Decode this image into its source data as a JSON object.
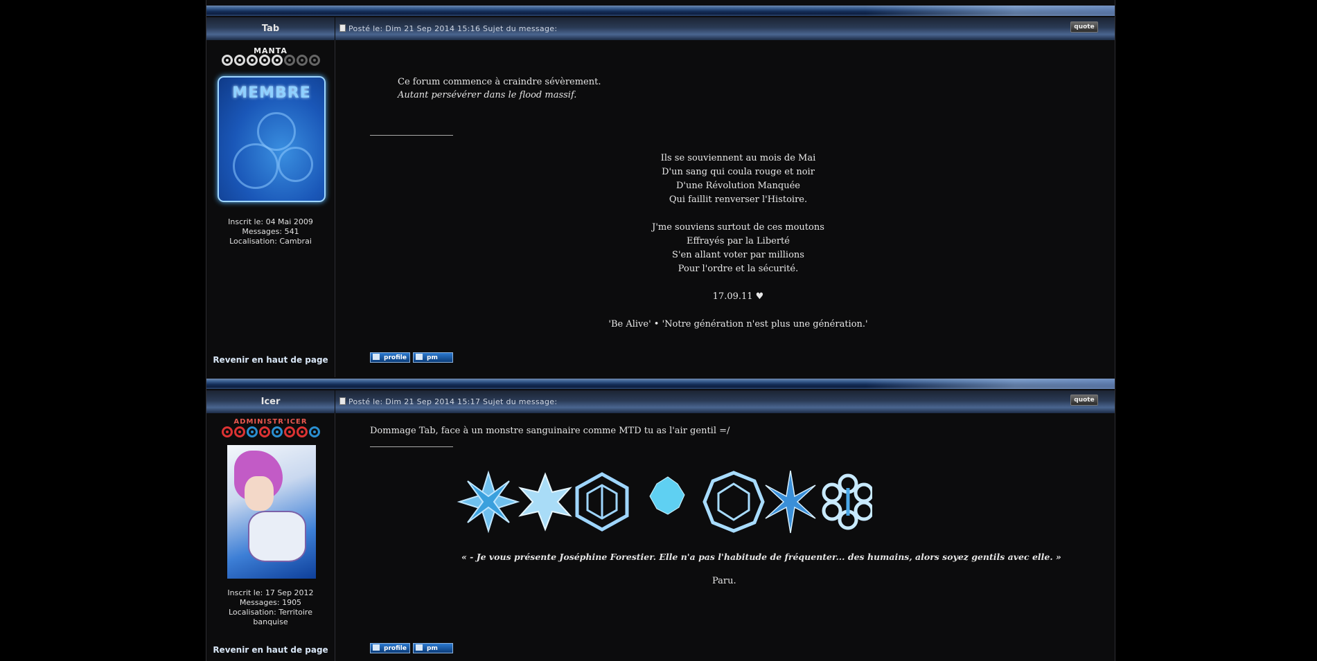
{
  "posts": [
    {
      "author": "Tab",
      "header": "Posté le: Dim 21 Sep 2014 15:16    Sujet du message:",
      "quote_label": "quote",
      "rank_title": "MANTA",
      "avatar_text": "MEMBRE",
      "joined": "Inscrit le: 04 Mai 2009",
      "messages": "Messages: 541",
      "location": "Localisation: Cambrai",
      "body_line1": "Ce forum commence à craindre sévèrement.",
      "body_line2": "Autant persévérer dans le flood massif.",
      "signature": [
        "Ils se souviennent au mois de Mai",
        "D'un sang qui coula rouge et noir",
        "D'une Révolution Manquée",
        "Qui faillit renverser l'Histoire.",
        "",
        "J'me souviens surtout de ces moutons",
        "Effrayés par la Liberté",
        "S'en allant voter par millions",
        "Pour l'ordre et la sécurité.",
        "",
        "17.09.11 ♥",
        "",
        "'Be Alive' • 'Notre génération n'est plus une génération.'"
      ],
      "back_to_top": "Revenir en haut de page",
      "profile_label": "profile",
      "pm_label": "pm"
    },
    {
      "author": "Icer",
      "header": "Posté le: Dim 21 Sep 2014 15:17    Sujet du message:",
      "quote_label": "quote",
      "rank_title": "ADMINISTR'ICER",
      "joined": "Inscrit le: 17 Sep 2012",
      "messages": "Messages: 1905",
      "location": "Localisation: Territoire banquise",
      "body_line1": "Dommage Tab, face à un monstre sanguinaire comme MTD tu as l'air gentil =/",
      "quote_text": "« - Je vous présente Joséphine Forestier. Elle n'a pas l'habitude de fréquenter... des humains, alors soyez gentils avec elle. »",
      "sig_name": "Paru.",
      "back_to_top": "Revenir en haut de page",
      "profile_label": "profile",
      "pm_label": "pm"
    }
  ],
  "colors": {
    "background": "#000000",
    "panel": "#0c0c0d",
    "accent": "#2c7ad0",
    "ice": "#9fd6ff"
  },
  "icons": [
    "post-icon",
    "rank-shuriken-icon",
    "snowflake-icon",
    "profile-icon",
    "pm-icon"
  ]
}
